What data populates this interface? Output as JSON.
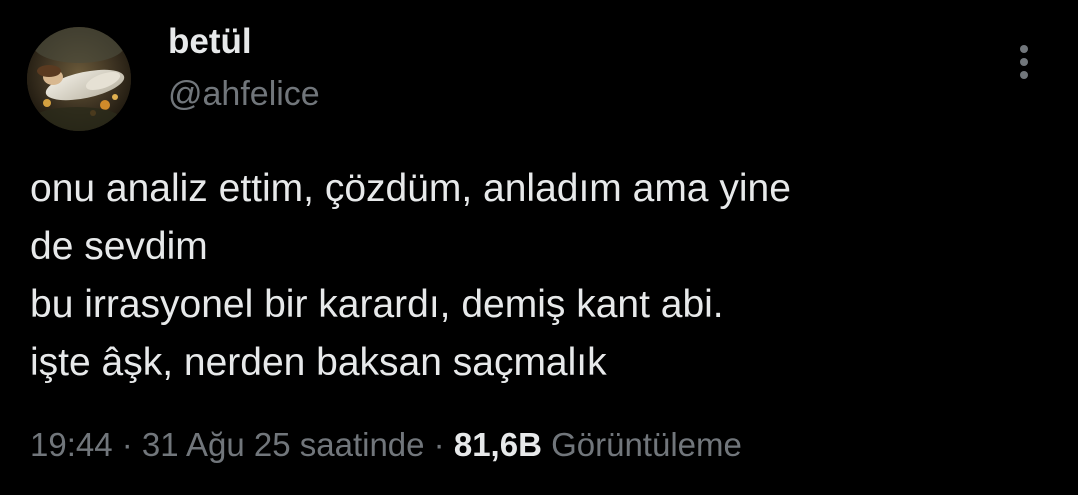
{
  "author": {
    "display_name": "betül",
    "handle": "@ahfelice",
    "avatar": "painting-avatar"
  },
  "more_icon": "more-vertical-icon",
  "tweet": {
    "lines": [
      "onu analiz ettim, çözdüm, anladım ama yine",
      "de sevdim",
      "bu irrasyonel bir karardı, demiş kant abi.",
      "işte âşk, nerden baksan saçmalık"
    ]
  },
  "meta": {
    "time": "19:44",
    "separator1": " · ",
    "date": "31 Ağu 25 saatinde",
    "separator2": " · ",
    "views_count": "81,6B",
    "views_label": "Görüntüleme"
  },
  "colors": {
    "background": "#000000",
    "primary_text": "#e7e9ea",
    "secondary_text": "#71767b"
  }
}
